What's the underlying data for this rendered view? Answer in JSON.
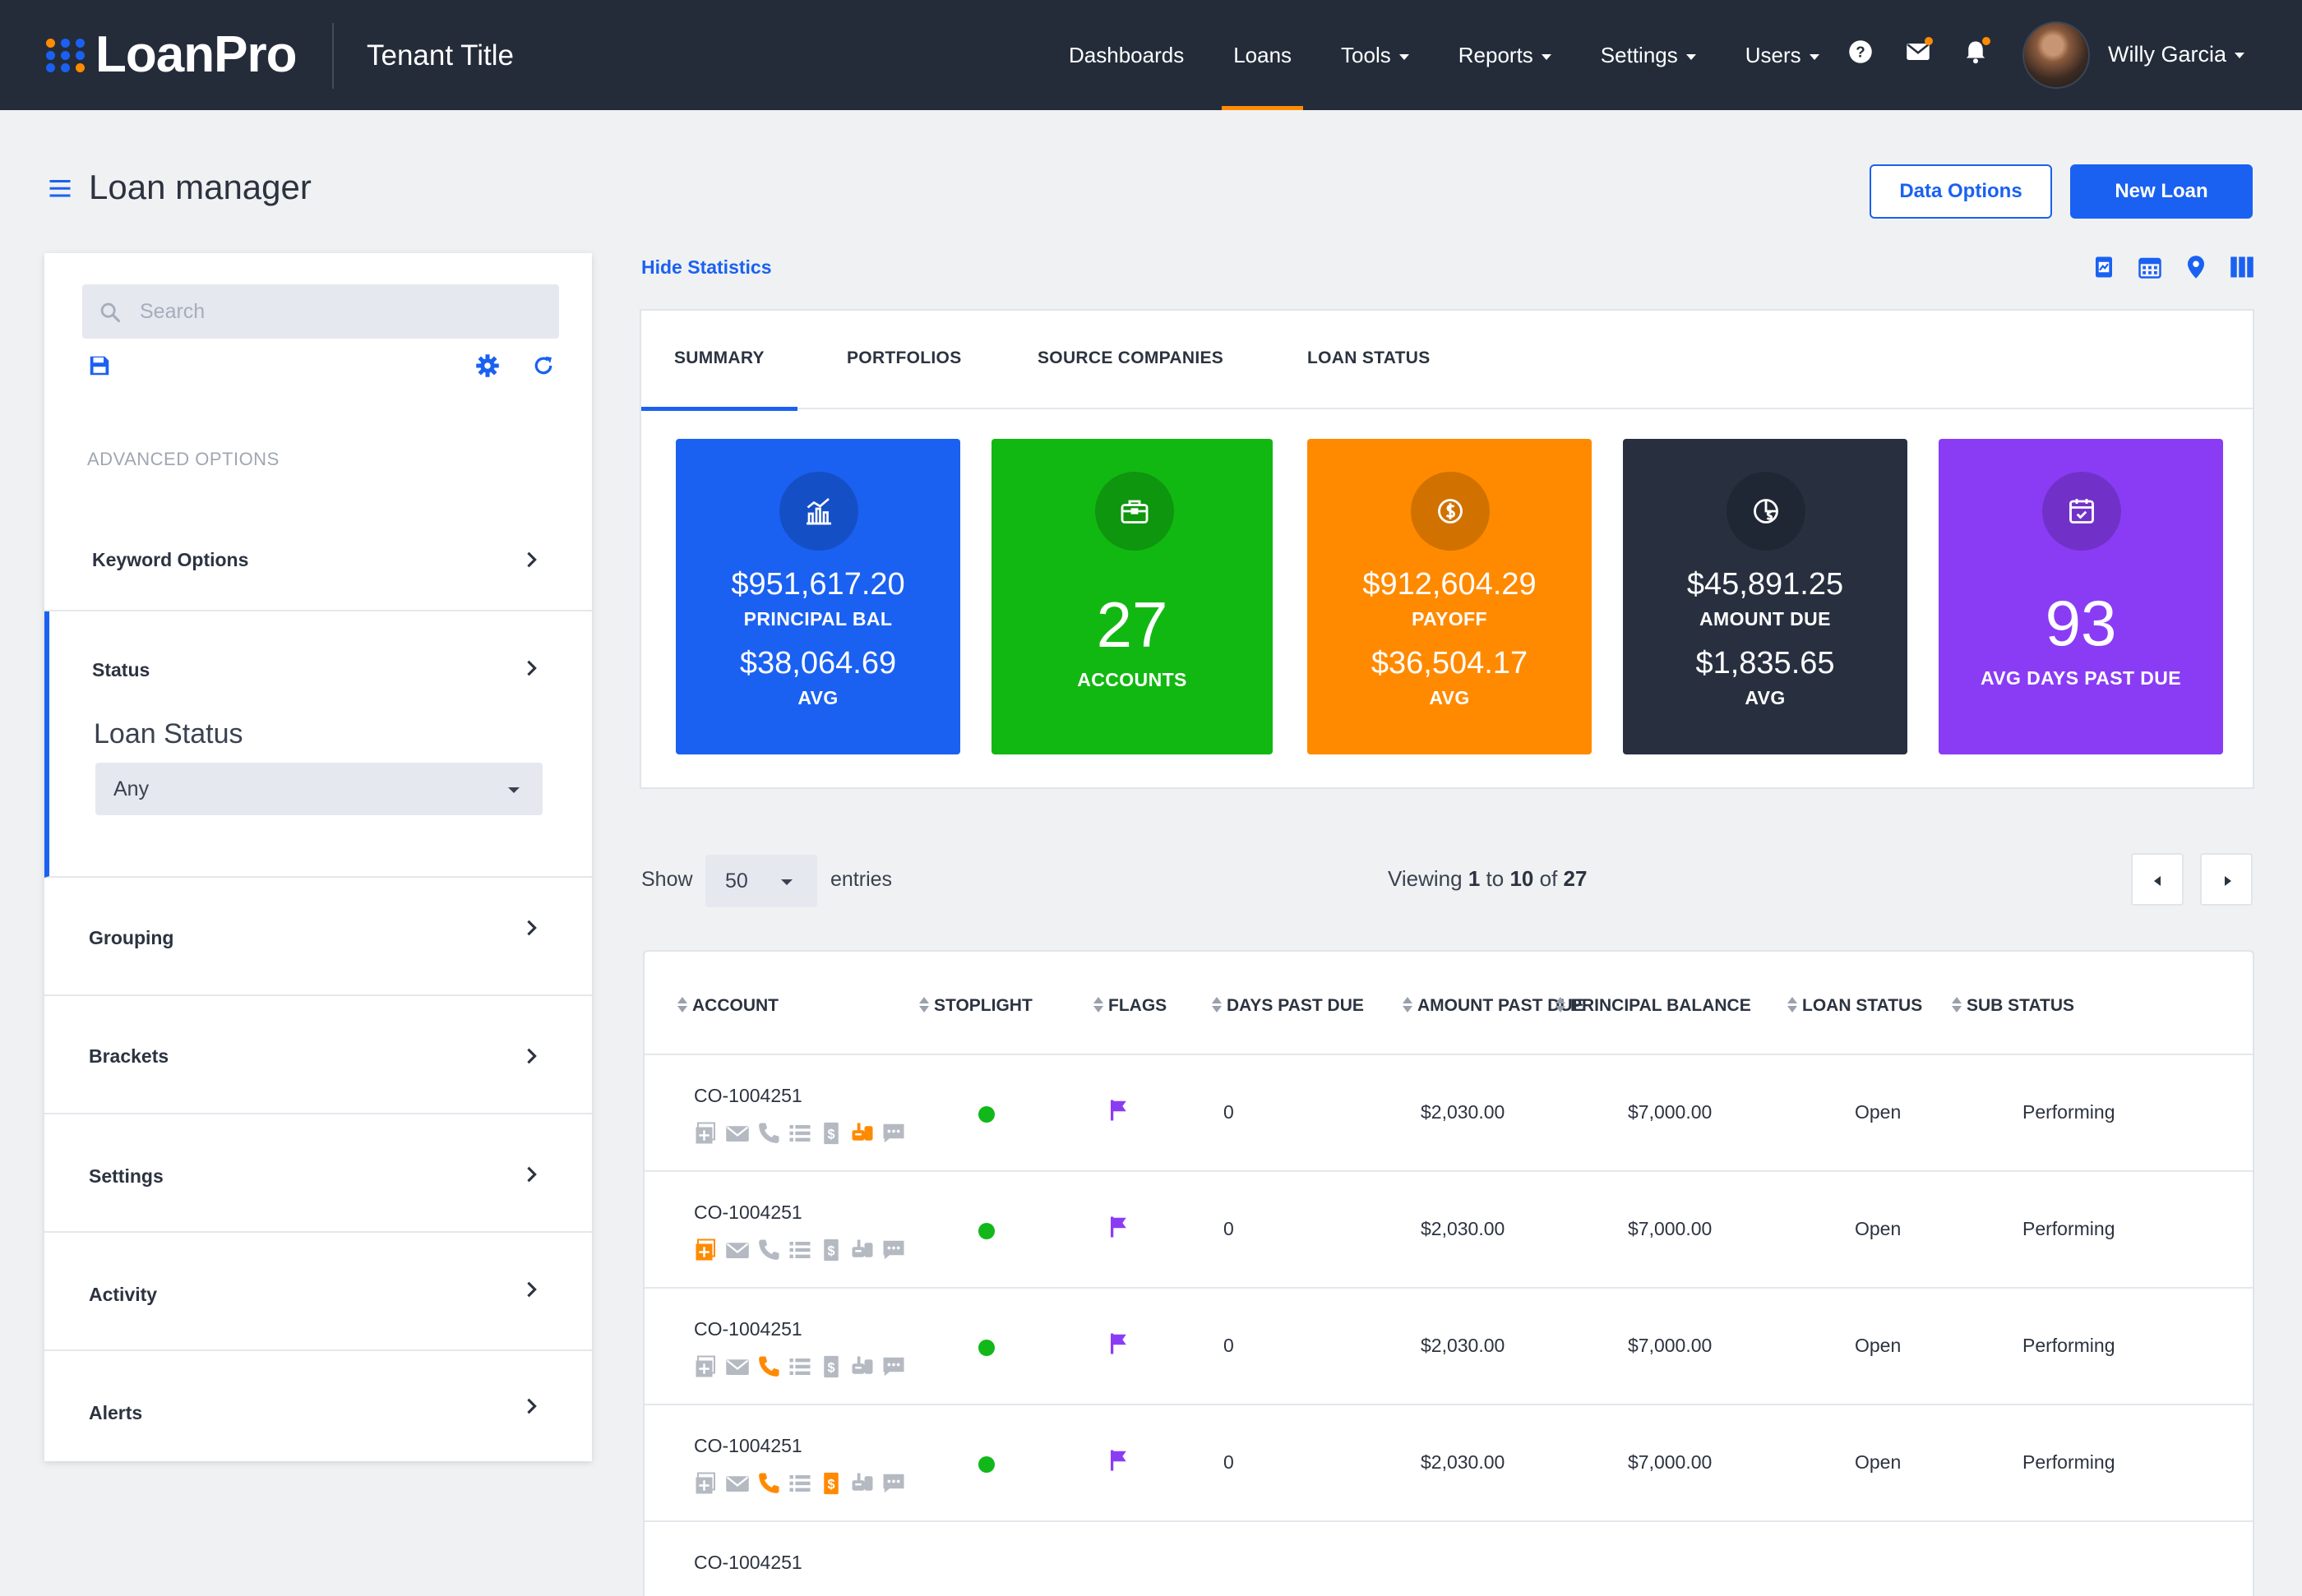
{
  "app": {
    "name": "LoanPro",
    "tenant_title": "Tenant Title"
  },
  "nav": [
    {
      "label": "Dashboards",
      "dropdown": false,
      "active": false
    },
    {
      "label": "Loans",
      "dropdown": false,
      "active": true
    },
    {
      "label": "Tools",
      "dropdown": true,
      "active": false
    },
    {
      "label": "Reports",
      "dropdown": true,
      "active": false
    },
    {
      "label": "Settings",
      "dropdown": true,
      "active": false
    },
    {
      "label": "Users",
      "dropdown": true,
      "active": false
    }
  ],
  "user": {
    "name": "Willy Garcia"
  },
  "page": {
    "title": "Loan manager",
    "data_options_label": "Data Options",
    "new_loan_label": "New Loan"
  },
  "sidebar": {
    "search_placeholder": "Search",
    "advanced_label": "ADVANCED OPTIONS",
    "items": [
      {
        "label": "Keyword Options"
      },
      {
        "label": "Status"
      },
      {
        "label": "Grouping"
      },
      {
        "label": "Brackets"
      },
      {
        "label": "Settings"
      },
      {
        "label": "Activity"
      },
      {
        "label": "Alerts"
      }
    ],
    "status_filter": {
      "label": "Loan Status",
      "value": "Any"
    }
  },
  "stats": {
    "hide_label": "Hide Statistics",
    "tabs": [
      "SUMMARY",
      "PORTFOLIOS",
      "SOURCE COMPANIES",
      "LOAN STATUS"
    ],
    "active_tab": "SUMMARY",
    "cards": [
      {
        "icon": "chart-icon",
        "color": "#1a61f2",
        "value": "$951,617.20",
        "label": "PRINCIPAL BAL",
        "sub_value": "$38,064.69",
        "sub_label": "AVG"
      },
      {
        "icon": "briefcase-icon",
        "color": "#12b812",
        "value": "27",
        "label": "ACCOUNTS"
      },
      {
        "icon": "dollar-coin-icon",
        "color": "#ff8a00",
        "value": "$912,604.29",
        "label": "PAYOFF",
        "sub_value": "$36,504.17",
        "sub_label": "AVG"
      },
      {
        "icon": "pie-dollar-icon",
        "color": "#283040",
        "value": "$45,891.25",
        "label": "AMOUNT DUE",
        "sub_value": "$1,835.65",
        "sub_label": "AVG"
      },
      {
        "icon": "calendar-check-icon",
        "color": "#8a3cf5",
        "value": "93",
        "label": "AVG DAYS PAST DUE"
      }
    ]
  },
  "table": {
    "show_label": "Show",
    "page_size": "50",
    "entries_label": "entries",
    "viewing": {
      "prefix": "Viewing",
      "from": "1",
      "to_word": "to",
      "to": "10",
      "of_word": "of",
      "total": "27"
    },
    "columns": [
      "ACCOUNT",
      "STOPLIGHT",
      "FLAGS",
      "DAYS PAST DUE",
      "AMOUNT PAST DUE",
      "PRINCIPAL BALANCE",
      "LOAN STATUS",
      "SUB STATUS"
    ],
    "rows": [
      {
        "account": "CO-1004251",
        "stoplight": "green",
        "flag_color": "#8a3cf5",
        "days_past_due": "0",
        "amount_past_due": "$2,030.00",
        "principal_balance": "$7,000.00",
        "loan_status": "Open",
        "sub_status": "Performing",
        "highlighted_icons": [
          "mail-truck-icon"
        ]
      },
      {
        "account": "CO-1004251",
        "stoplight": "green",
        "flag_color": "#8a3cf5",
        "days_past_due": "0",
        "amount_past_due": "$2,030.00",
        "principal_balance": "$7,000.00",
        "loan_status": "Open",
        "sub_status": "Performing",
        "highlighted_icons": [
          "add-note-icon"
        ]
      },
      {
        "account": "CO-1004251",
        "stoplight": "green",
        "flag_color": "#8a3cf5",
        "days_past_due": "0",
        "amount_past_due": "$2,030.00",
        "principal_balance": "$7,000.00",
        "loan_status": "Open",
        "sub_status": "Performing",
        "highlighted_icons": [
          "phone-icon"
        ]
      },
      {
        "account": "CO-1004251",
        "stoplight": "green",
        "flag_color": "#8a3cf5",
        "days_past_due": "0",
        "amount_past_due": "$2,030.00",
        "principal_balance": "$7,000.00",
        "loan_status": "Open",
        "sub_status": "Performing",
        "highlighted_icons": [
          "phone-icon",
          "dollar-doc-icon"
        ]
      },
      {
        "account": "CO-1004251"
      }
    ]
  },
  "colors": {
    "nav_bg": "#242c3a",
    "accent": "#ff8b00",
    "primary": "#1a61f2",
    "icon_gray": "#b4b9c2",
    "icon_highlight": "#ff8a00"
  }
}
